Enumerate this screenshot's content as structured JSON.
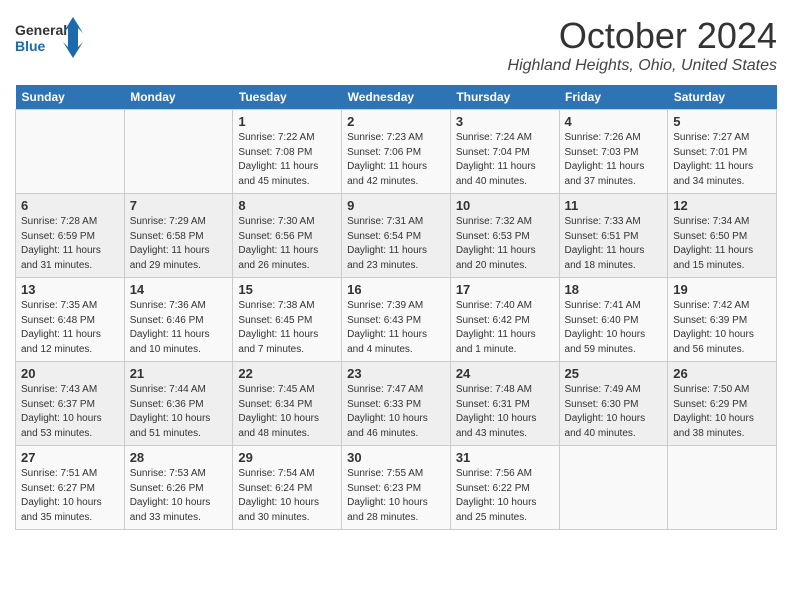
{
  "header": {
    "logo_line1": "General",
    "logo_line2": "Blue",
    "month": "October 2024",
    "location": "Highland Heights, Ohio, United States"
  },
  "weekdays": [
    "Sunday",
    "Monday",
    "Tuesday",
    "Wednesday",
    "Thursday",
    "Friday",
    "Saturday"
  ],
  "weeks": [
    [
      {
        "day": "",
        "info": ""
      },
      {
        "day": "",
        "info": ""
      },
      {
        "day": "1",
        "info": "Sunrise: 7:22 AM\nSunset: 7:08 PM\nDaylight: 11 hours and 45 minutes."
      },
      {
        "day": "2",
        "info": "Sunrise: 7:23 AM\nSunset: 7:06 PM\nDaylight: 11 hours and 42 minutes."
      },
      {
        "day": "3",
        "info": "Sunrise: 7:24 AM\nSunset: 7:04 PM\nDaylight: 11 hours and 40 minutes."
      },
      {
        "day": "4",
        "info": "Sunrise: 7:26 AM\nSunset: 7:03 PM\nDaylight: 11 hours and 37 minutes."
      },
      {
        "day": "5",
        "info": "Sunrise: 7:27 AM\nSunset: 7:01 PM\nDaylight: 11 hours and 34 minutes."
      }
    ],
    [
      {
        "day": "6",
        "info": "Sunrise: 7:28 AM\nSunset: 6:59 PM\nDaylight: 11 hours and 31 minutes."
      },
      {
        "day": "7",
        "info": "Sunrise: 7:29 AM\nSunset: 6:58 PM\nDaylight: 11 hours and 29 minutes."
      },
      {
        "day": "8",
        "info": "Sunrise: 7:30 AM\nSunset: 6:56 PM\nDaylight: 11 hours and 26 minutes."
      },
      {
        "day": "9",
        "info": "Sunrise: 7:31 AM\nSunset: 6:54 PM\nDaylight: 11 hours and 23 minutes."
      },
      {
        "day": "10",
        "info": "Sunrise: 7:32 AM\nSunset: 6:53 PM\nDaylight: 11 hours and 20 minutes."
      },
      {
        "day": "11",
        "info": "Sunrise: 7:33 AM\nSunset: 6:51 PM\nDaylight: 11 hours and 18 minutes."
      },
      {
        "day": "12",
        "info": "Sunrise: 7:34 AM\nSunset: 6:50 PM\nDaylight: 11 hours and 15 minutes."
      }
    ],
    [
      {
        "day": "13",
        "info": "Sunrise: 7:35 AM\nSunset: 6:48 PM\nDaylight: 11 hours and 12 minutes."
      },
      {
        "day": "14",
        "info": "Sunrise: 7:36 AM\nSunset: 6:46 PM\nDaylight: 11 hours and 10 minutes."
      },
      {
        "day": "15",
        "info": "Sunrise: 7:38 AM\nSunset: 6:45 PM\nDaylight: 11 hours and 7 minutes."
      },
      {
        "day": "16",
        "info": "Sunrise: 7:39 AM\nSunset: 6:43 PM\nDaylight: 11 hours and 4 minutes."
      },
      {
        "day": "17",
        "info": "Sunrise: 7:40 AM\nSunset: 6:42 PM\nDaylight: 11 hours and 1 minute."
      },
      {
        "day": "18",
        "info": "Sunrise: 7:41 AM\nSunset: 6:40 PM\nDaylight: 10 hours and 59 minutes."
      },
      {
        "day": "19",
        "info": "Sunrise: 7:42 AM\nSunset: 6:39 PM\nDaylight: 10 hours and 56 minutes."
      }
    ],
    [
      {
        "day": "20",
        "info": "Sunrise: 7:43 AM\nSunset: 6:37 PM\nDaylight: 10 hours and 53 minutes."
      },
      {
        "day": "21",
        "info": "Sunrise: 7:44 AM\nSunset: 6:36 PM\nDaylight: 10 hours and 51 minutes."
      },
      {
        "day": "22",
        "info": "Sunrise: 7:45 AM\nSunset: 6:34 PM\nDaylight: 10 hours and 48 minutes."
      },
      {
        "day": "23",
        "info": "Sunrise: 7:47 AM\nSunset: 6:33 PM\nDaylight: 10 hours and 46 minutes."
      },
      {
        "day": "24",
        "info": "Sunrise: 7:48 AM\nSunset: 6:31 PM\nDaylight: 10 hours and 43 minutes."
      },
      {
        "day": "25",
        "info": "Sunrise: 7:49 AM\nSunset: 6:30 PM\nDaylight: 10 hours and 40 minutes."
      },
      {
        "day": "26",
        "info": "Sunrise: 7:50 AM\nSunset: 6:29 PM\nDaylight: 10 hours and 38 minutes."
      }
    ],
    [
      {
        "day": "27",
        "info": "Sunrise: 7:51 AM\nSunset: 6:27 PM\nDaylight: 10 hours and 35 minutes."
      },
      {
        "day": "28",
        "info": "Sunrise: 7:53 AM\nSunset: 6:26 PM\nDaylight: 10 hours and 33 minutes."
      },
      {
        "day": "29",
        "info": "Sunrise: 7:54 AM\nSunset: 6:24 PM\nDaylight: 10 hours and 30 minutes."
      },
      {
        "day": "30",
        "info": "Sunrise: 7:55 AM\nSunset: 6:23 PM\nDaylight: 10 hours and 28 minutes."
      },
      {
        "day": "31",
        "info": "Sunrise: 7:56 AM\nSunset: 6:22 PM\nDaylight: 10 hours and 25 minutes."
      },
      {
        "day": "",
        "info": ""
      },
      {
        "day": "",
        "info": ""
      }
    ]
  ]
}
